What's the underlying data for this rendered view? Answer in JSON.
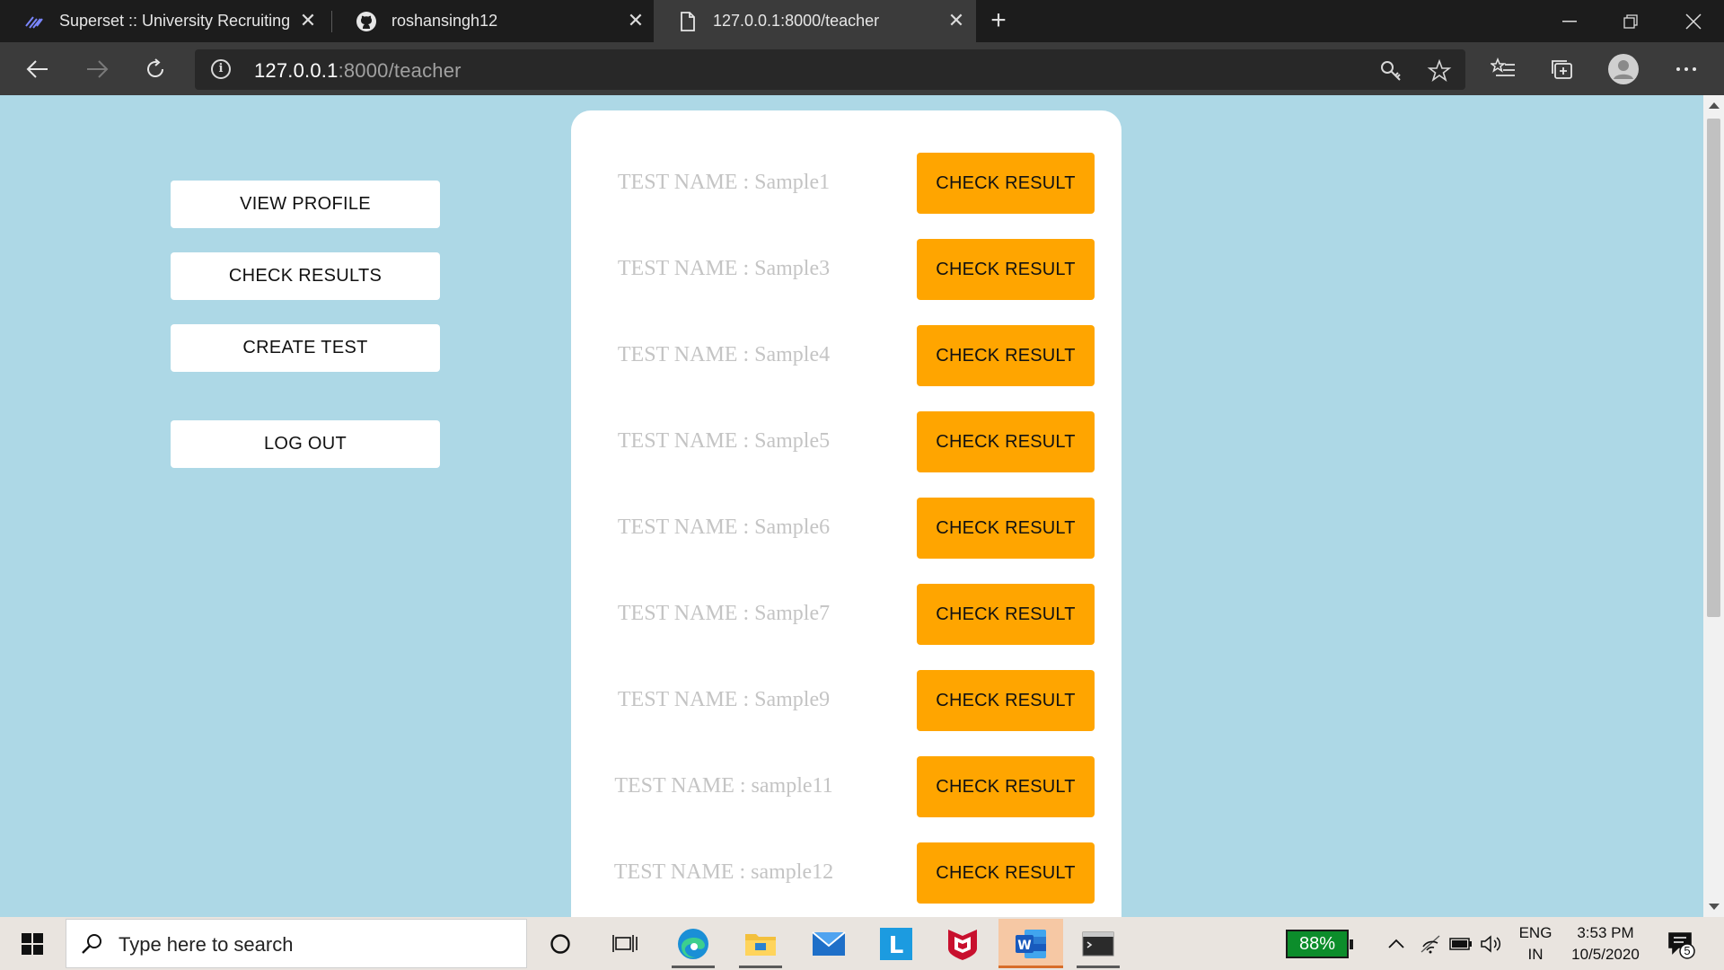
{
  "browser": {
    "tabs": [
      {
        "title": "Superset :: University Recruiting",
        "icon": "superset-logo-icon"
      },
      {
        "title": "roshansingh12",
        "icon": "github-icon"
      },
      {
        "title": "127.0.0.1:8000/teacher",
        "icon": "page-icon"
      }
    ],
    "address": {
      "host": "127.0.0.1",
      "path": ":8000/teacher"
    }
  },
  "sidebar": {
    "view_profile": "VIEW PROFILE",
    "check_results": "CHECK RESULTS",
    "create_test": "CREATE TEST",
    "log_out": "LOG OUT"
  },
  "tests": [
    {
      "name": "TEST NAME : Sample1",
      "button": "CHECK RESULT"
    },
    {
      "name": "TEST NAME : Sample3",
      "button": "CHECK RESULT"
    },
    {
      "name": "TEST NAME : Sample4",
      "button": "CHECK RESULT"
    },
    {
      "name": "TEST NAME : Sample5",
      "button": "CHECK RESULT"
    },
    {
      "name": "TEST NAME : Sample6",
      "button": "CHECK RESULT"
    },
    {
      "name": "TEST NAME : Sample7",
      "button": "CHECK RESULT"
    },
    {
      "name": "TEST NAME : Sample9",
      "button": "CHECK RESULT"
    },
    {
      "name": "TEST NAME : sample11",
      "button": "CHECK RESULT"
    },
    {
      "name": "TEST NAME : sample12",
      "button": "CHECK RESULT"
    }
  ],
  "taskbar": {
    "search_placeholder": "Type here to search",
    "battery": "88%",
    "language": "ENG",
    "region": "IN",
    "time": "3:53 PM",
    "date": "10/5/2020",
    "notifications": "5"
  },
  "colors": {
    "page_background": "#add8e6",
    "check_button": "#ffa500",
    "card": "#ffffff",
    "test_name_text": "#c4c4c4"
  }
}
